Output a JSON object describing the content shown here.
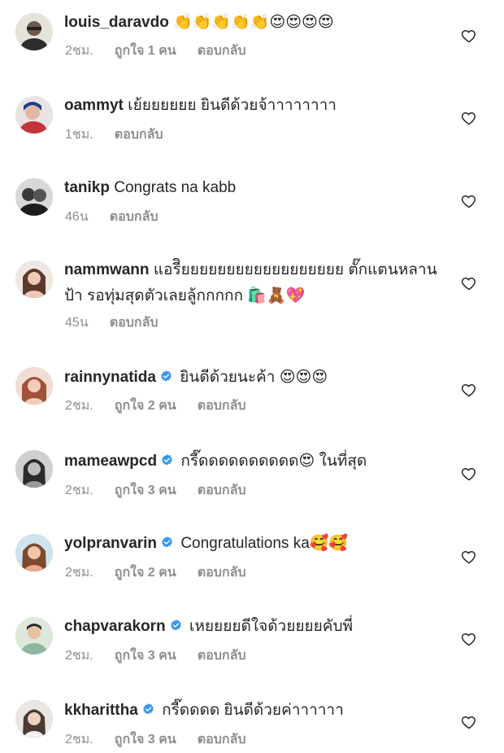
{
  "comments": [
    {
      "username": "louis_daravdo",
      "verified": false,
      "text": "👏👏👏👏👏😍😍😍😍",
      "time": "2ชม.",
      "likes": "ถูกใจ 1 คน",
      "reply": "ตอบกลับ",
      "avatar_color": "#5a5a5a"
    },
    {
      "username": "oammyt",
      "verified": false,
      "text": "เย้ยยยยยย ยินดีด้วยจ้าาาาาาาา",
      "time": "1ชม.",
      "likes": "",
      "reply": "ตอบกลับ",
      "avatar_color": "#c0343a"
    },
    {
      "username": "tanikp",
      "verified": false,
      "text": "Congrats na kabb",
      "time": "46น",
      "likes": "",
      "reply": "ตอบกลับ",
      "avatar_color": "#3a3a3a"
    },
    {
      "username": "nammwann",
      "verified": false,
      "text": "แอรีิยยยยยยยยยยยยยยยยยย ตั๊กแตนหลานป้า รอทุ่มสุดตัวเลยลู้กกกกก 🛍️🧸💖",
      "time": "45น",
      "likes": "",
      "reply": "ตอบกลับ",
      "avatar_color": "#a8796a"
    },
    {
      "username": "rainnynatida",
      "verified": true,
      "text": "ยินดีด้วยนะค้า 😍😍😍",
      "time": "2ชม.",
      "likes": "ถูกใจ 2 คน",
      "reply": "ตอบกลับ",
      "avatar_color": "#d79a86"
    },
    {
      "username": "mameawpcd",
      "verified": true,
      "text": "กรี๊ดดดดดดดดดด😍 ในที่สุด",
      "time": "2ชม.",
      "likes": "ถูกใจ 3 คน",
      "reply": "ตอบกลับ",
      "avatar_color": "#4a4a4a"
    },
    {
      "username": "yolpranvarin",
      "verified": true,
      "text": "Congratulations ka🥰🥰",
      "time": "2ชม.",
      "likes": "ถูกใจ 2 คน",
      "reply": "ตอบกลับ",
      "avatar_color": "#e2b39a"
    },
    {
      "username": "chapvarakorn",
      "verified": true,
      "text": "เหยยยยดีใจด้วยยยยคับพี่",
      "time": "2ชม.",
      "likes": "ถูกใจ 3 คน",
      "reply": "ตอบกลับ",
      "avatar_color": "#8fa78c"
    },
    {
      "username": "kkharittha",
      "verified": true,
      "text": "กรี๊ดดดด ยินดีด้วยค่าาาาาา",
      "time": "2ชม.",
      "likes": "ถูกใจ 3 คน",
      "reply": "ตอบกลับ",
      "avatar_color": "#b9b2ab"
    }
  ],
  "colors": {
    "text": "#262626",
    "meta": "#8e8e8e",
    "verified": "#3897f0"
  }
}
